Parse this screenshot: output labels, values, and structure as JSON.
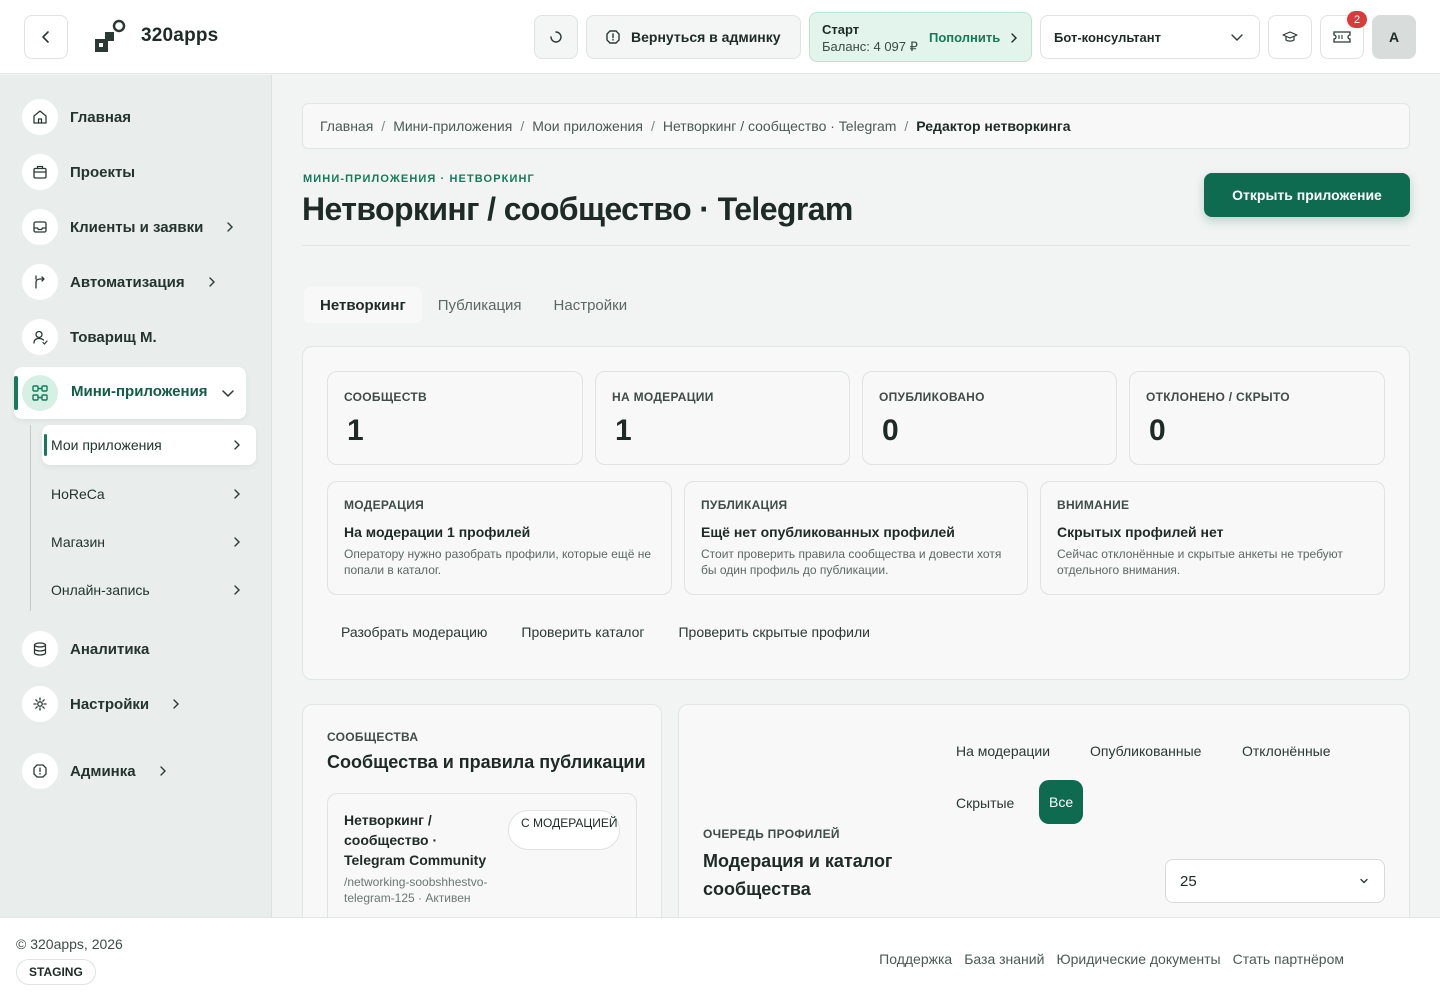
{
  "header": {
    "brand": "320apps",
    "admin_button": "Вернуться в админку",
    "balance": {
      "plan": "Старт",
      "amount": "Баланс: 4 097 ₽",
      "topup": "Пополнить"
    },
    "bot_select": "Бот-консультант",
    "notifications_count": "2",
    "avatar_letter": "A"
  },
  "sidebar": {
    "items": [
      {
        "label": "Главная",
        "icon": "home-icon"
      },
      {
        "label": "Проекты",
        "icon": "briefcase-icon"
      },
      {
        "label": "Клиенты и заявки",
        "icon": "inbox-icon"
      },
      {
        "label": "Автоматизация",
        "icon": "route-icon"
      },
      {
        "label": "Товарищ М.",
        "icon": "user-icon"
      },
      {
        "label": "Мини-приложения",
        "icon": "apps-icon"
      },
      {
        "label": "Аналитика",
        "icon": "database-icon"
      },
      {
        "label": "Настройки",
        "icon": "gear-icon"
      },
      {
        "label": "Админка",
        "icon": "shield-icon"
      }
    ],
    "sub_items": [
      "Мои приложения",
      "HoReCa",
      "Магазин",
      "Онлайн-запись"
    ]
  },
  "breadcrumb": [
    "Главная",
    "Мини-приложения",
    "Мои приложения",
    "Нетворкинг / сообщество · Telegram",
    "Редактор нетворкинга"
  ],
  "page": {
    "eyebrow": "МИНИ-ПРИЛОЖЕНИЯ · НЕТВОРКИНГ",
    "title": "Нетворкинг / сообщество · Telegram",
    "open_button": "Открыть приложение",
    "tabs": [
      "Нетворкинг",
      "Публикация",
      "Настройки"
    ]
  },
  "stats": [
    {
      "label": "СООБЩЕСТВ",
      "value": "1"
    },
    {
      "label": "НА МОДЕРАЦИИ",
      "value": "1"
    },
    {
      "label": "ОПУБЛИКОВАНО",
      "value": "0"
    },
    {
      "label": "ОТКЛОНЕНО / СКРЫТО",
      "value": "0"
    }
  ],
  "info_cards": [
    {
      "label": "МОДЕРАЦИЯ",
      "heading": "На модерации 1 профилей",
      "text": "Оператору нужно разобрать профили, которые ещё не попали в каталог."
    },
    {
      "label": "ПУБЛИКАЦИЯ",
      "heading": "Ещё нет опубликованных профилей",
      "text": "Стоит проверить правила сообщества и довести хотя бы один профиль до публикации."
    },
    {
      "label": "ВНИМАНИЕ",
      "heading": "Скрытых профилей нет",
      "text": "Сейчас отклонённые и скрытые анкеты не требуют отдельного внимания."
    }
  ],
  "actions": [
    "Разобрать модерацию",
    "Проверить каталог",
    "Проверить скрытые профили"
  ],
  "communities": {
    "label": "СООБЩЕСТВА",
    "heading": "Сообщества и правила публикации",
    "card": {
      "name": "Нетворкинг / сообщество · Telegram Community",
      "slug": "/networking-soobshhestvo-telegram-125 · Активен",
      "badge": "С МОДЕРАЦИЕЙ"
    }
  },
  "queue": {
    "filters": [
      "На модерации",
      "Опубликованные",
      "Отклонённые",
      "Скрытые",
      "Все"
    ],
    "label": "ОЧЕРЕДЬ ПРОФИЛЕЙ",
    "heading": "Модерация и каталог сообщества",
    "page_size": "25"
  },
  "footer": {
    "copyright": "© 320apps, 2026",
    "env_badge": "STAGING",
    "links": [
      "Поддержка",
      "База знаний",
      "Юридические документы",
      "Стать партнёром"
    ]
  },
  "colors": {
    "accent": "#0f6b50",
    "accent_light": "#e3f4ec",
    "badge": "#d93a3a"
  }
}
